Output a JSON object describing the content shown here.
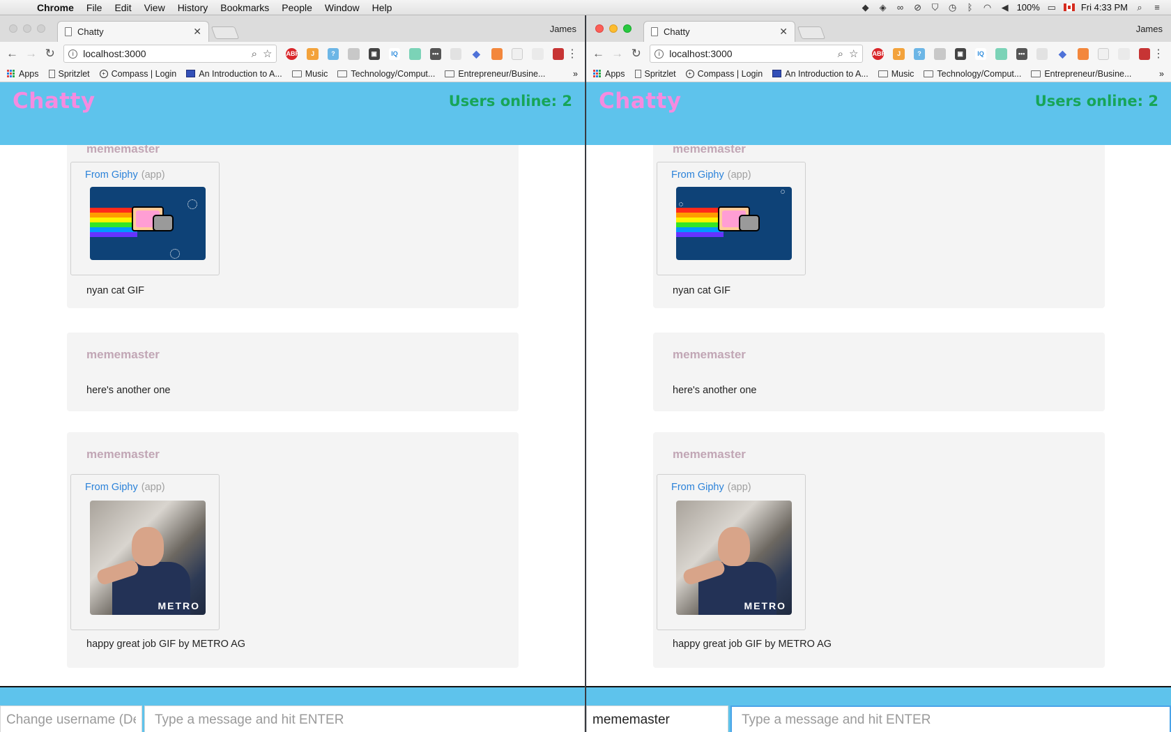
{
  "menubar": {
    "app_name": "Chrome",
    "items": [
      "File",
      "Edit",
      "View",
      "History",
      "Bookmarks",
      "People",
      "Window",
      "Help"
    ],
    "battery": "100%",
    "clock": "Fri 4:33 PM"
  },
  "browser": {
    "tab_title": "Chatty",
    "profile": "James",
    "url": "localhost:3000",
    "bookmarks": [
      "Apps",
      "Spritzlet",
      "Compass | Login",
      "An Introduction to A...",
      "Music",
      "Technology/Comput...",
      "Entrepreneur/Busine..."
    ],
    "bookmarks_more": "»"
  },
  "app": {
    "brand": "Chatty",
    "users_online": "Users online: 2",
    "messages": [
      {
        "username": "mememaster",
        "source": "From Giphy",
        "source_tag": "(app)",
        "gif_caption": "nyan cat GIF"
      },
      {
        "username": "mememaster",
        "text": "here's another one"
      },
      {
        "username": "mememaster",
        "source": "From Giphy",
        "source_tag": "(app)",
        "gif_caption": "happy great job GIF by METRO AG",
        "watermark": "METRO"
      }
    ],
    "left": {
      "username_placeholder": "Change username (De",
      "message_placeholder": "Type a message and hit ENTER"
    },
    "right": {
      "username_value": "mememaster",
      "message_placeholder": "Type a message and hit ENTER"
    }
  },
  "colors": {
    "app_bar": "#5ec3ec",
    "brand": "#f58be0",
    "online": "#17a558",
    "username": "#c1a6b5",
    "link": "#2b82d9"
  }
}
